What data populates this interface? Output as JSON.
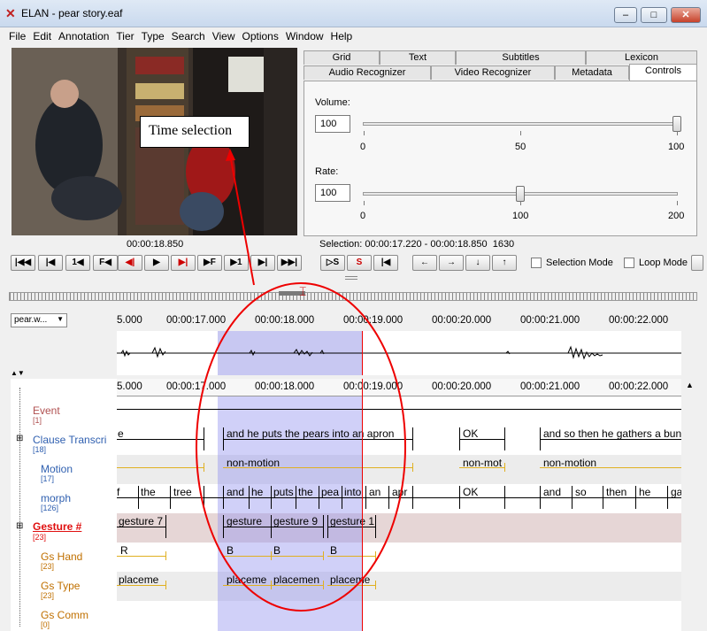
{
  "window": {
    "title": "ELAN - pear story.eaf",
    "min": "–",
    "max": "□",
    "close": "✕"
  },
  "menu": [
    "File",
    "Edit",
    "Annotation",
    "Tier",
    "Type",
    "Search",
    "View",
    "Options",
    "Window",
    "Help"
  ],
  "tabs_row1": [
    "Grid",
    "Text",
    "Subtitles",
    "Lexicon"
  ],
  "tabs_row2": [
    "Audio Recognizer",
    "Video Recognizer",
    "Metadata",
    "Controls"
  ],
  "controls": {
    "volume_label": "Volume:",
    "volume_value": "100",
    "volume_ticks": [
      "0",
      "50",
      "100"
    ],
    "volume_level": 1.0,
    "rate_label": "Rate:",
    "rate_value": "100",
    "rate_ticks": [
      "0",
      "100",
      "200"
    ],
    "rate_level": 0.5
  },
  "media": {
    "current_time": "00:00:18.850",
    "selection": "Selection: 00:00:17.220 - 00:00:18.850  1630",
    "buttons": [
      "|◀◀",
      "|◀",
      "1◀",
      "F◀",
      "◀|",
      "▶",
      "▶|",
      "▶F",
      "▶1",
      "▶|",
      "▶▶|"
    ],
    "sel_buttons": [
      "▷S",
      "S",
      "|◀"
    ],
    "nav_buttons": [
      "←",
      "→",
      "↓",
      "↑"
    ],
    "selection_mode": "Selection Mode",
    "loop_mode": "Loop Mode"
  },
  "callout": "Time selection",
  "waveform_selector": "pear.w...",
  "ruler": [
    {
      "t": "5.000"
    },
    {
      "t": "00:00:17.000"
    },
    {
      "t": "00:00:18.000"
    },
    {
      "t": "00:00:19.000"
    },
    {
      "t": "00:00:20.000"
    },
    {
      "t": "00:00:21.000"
    },
    {
      "t": "00:00:22.000"
    }
  ],
  "tiers": [
    {
      "name": "Event",
      "count": "[1]",
      "color": "#b05050"
    },
    {
      "name": "Clause Transcri",
      "count": "[18]",
      "color": "#3060b0"
    },
    {
      "name": "Motion",
      "count": "[17]",
      "color": "#3060b0"
    },
    {
      "name": "morph",
      "count": "[126]",
      "color": "#3060b0"
    },
    {
      "name": "Gesture #",
      "count": "[23]",
      "color": "#e01010"
    },
    {
      "name": "Gs Hand",
      "count": "[23]",
      "color": "#c07000"
    },
    {
      "name": "Gs Type",
      "count": "[23]",
      "color": "#c07000"
    },
    {
      "name": "Gs Comm",
      "count": "[0]",
      "color": "#c07000"
    }
  ],
  "annotations": {
    "clause": [
      "e",
      "and he puts the pears into an apron",
      "OK",
      "and so then he gathers a bun"
    ],
    "motion": [
      "non-motion",
      "non-mot",
      "non-motion"
    ],
    "morph": [
      "f",
      "the",
      "tree",
      "and",
      "he",
      "puts",
      "the",
      "pea",
      "into",
      "an",
      "apr",
      "OK",
      "and",
      "so",
      "then",
      "he",
      "ga"
    ],
    "gesture": [
      "gesture 7",
      "gesture",
      "gesture 9",
      "gesture 1"
    ],
    "gshand": [
      "R",
      "B",
      "B",
      "B"
    ],
    "gstype": [
      "placeme",
      "placeme",
      "placemen",
      "placeme"
    ]
  }
}
